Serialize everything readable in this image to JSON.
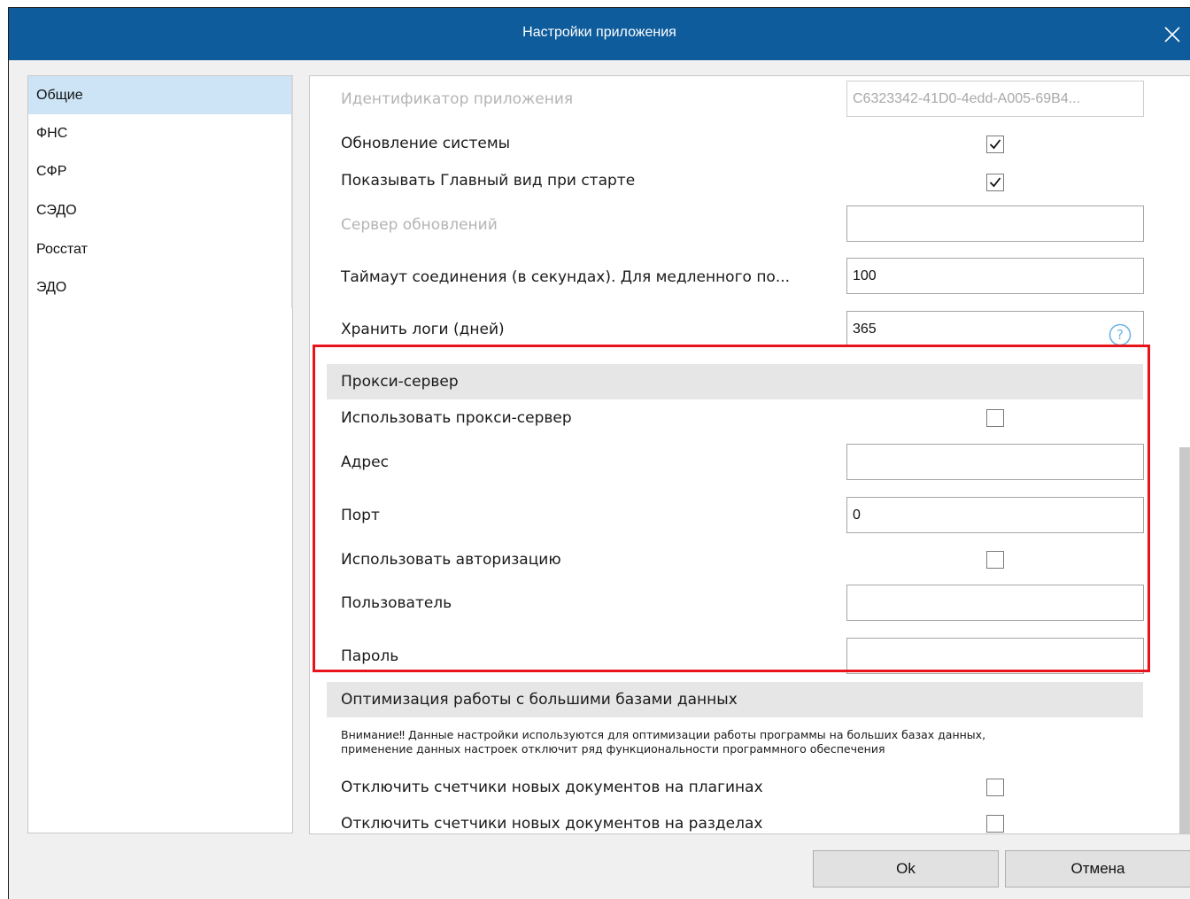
{
  "window": {
    "title": "Настройки приложения"
  },
  "sidebar": {
    "items": [
      {
        "label": "Общие",
        "active": true
      },
      {
        "label": "ФНС"
      },
      {
        "label": "СФР"
      },
      {
        "label": "СЭДО"
      },
      {
        "label": "Росстат"
      },
      {
        "label": "ЭДО"
      }
    ]
  },
  "general": {
    "app_id_label": "Идентификатор приложения",
    "app_id_value": "C6323342-41D0-4edd-A005-69B4...",
    "system_update_label": "Обновление системы",
    "system_update_checked": true,
    "show_main_view_label": "Показывать Главный вид при старте",
    "show_main_view_checked": true,
    "update_server_label": "Сервер обновлений",
    "update_server_value": "",
    "timeout_label": "Таймаут соединения (в секундах). Для медленного по...",
    "timeout_value": "100",
    "keep_logs_label": "Хранить логи (дней)",
    "keep_logs_value": "365"
  },
  "proxy": {
    "header": "Прокси-сервер",
    "use_proxy_label": "Использовать прокси-сервер",
    "use_proxy_checked": false,
    "address_label": "Адрес",
    "address_value": "",
    "port_label": "Порт",
    "port_value": "0",
    "use_auth_label": "Использовать авторизацию",
    "use_auth_checked": false,
    "user_label": "Пользователь",
    "user_value": "",
    "password_label": "Пароль",
    "password_value": ""
  },
  "optimization": {
    "header": "Оптимизация работы с большими базами данных",
    "notice_line1": "Внимание‼ Данные настройки используются для оптимизации работы программы на больших базах данных,",
    "notice_line2": "применение данных настроек отключит ряд функциональности программного обеспечения",
    "disable_plugin_counters_label": "Отключить счетчики новых документов на плагинах",
    "disable_plugin_counters_checked": false,
    "disable_section_counters_label": "Отключить счетчики новых документов на разделах",
    "disable_section_counters_checked": false
  },
  "buttons": {
    "ok": "Ok",
    "cancel": "Отмена"
  },
  "colors": {
    "titlebar": "#0e5c9c",
    "highlight": "#e8131b",
    "sidebar_active": "#cce4f6"
  }
}
